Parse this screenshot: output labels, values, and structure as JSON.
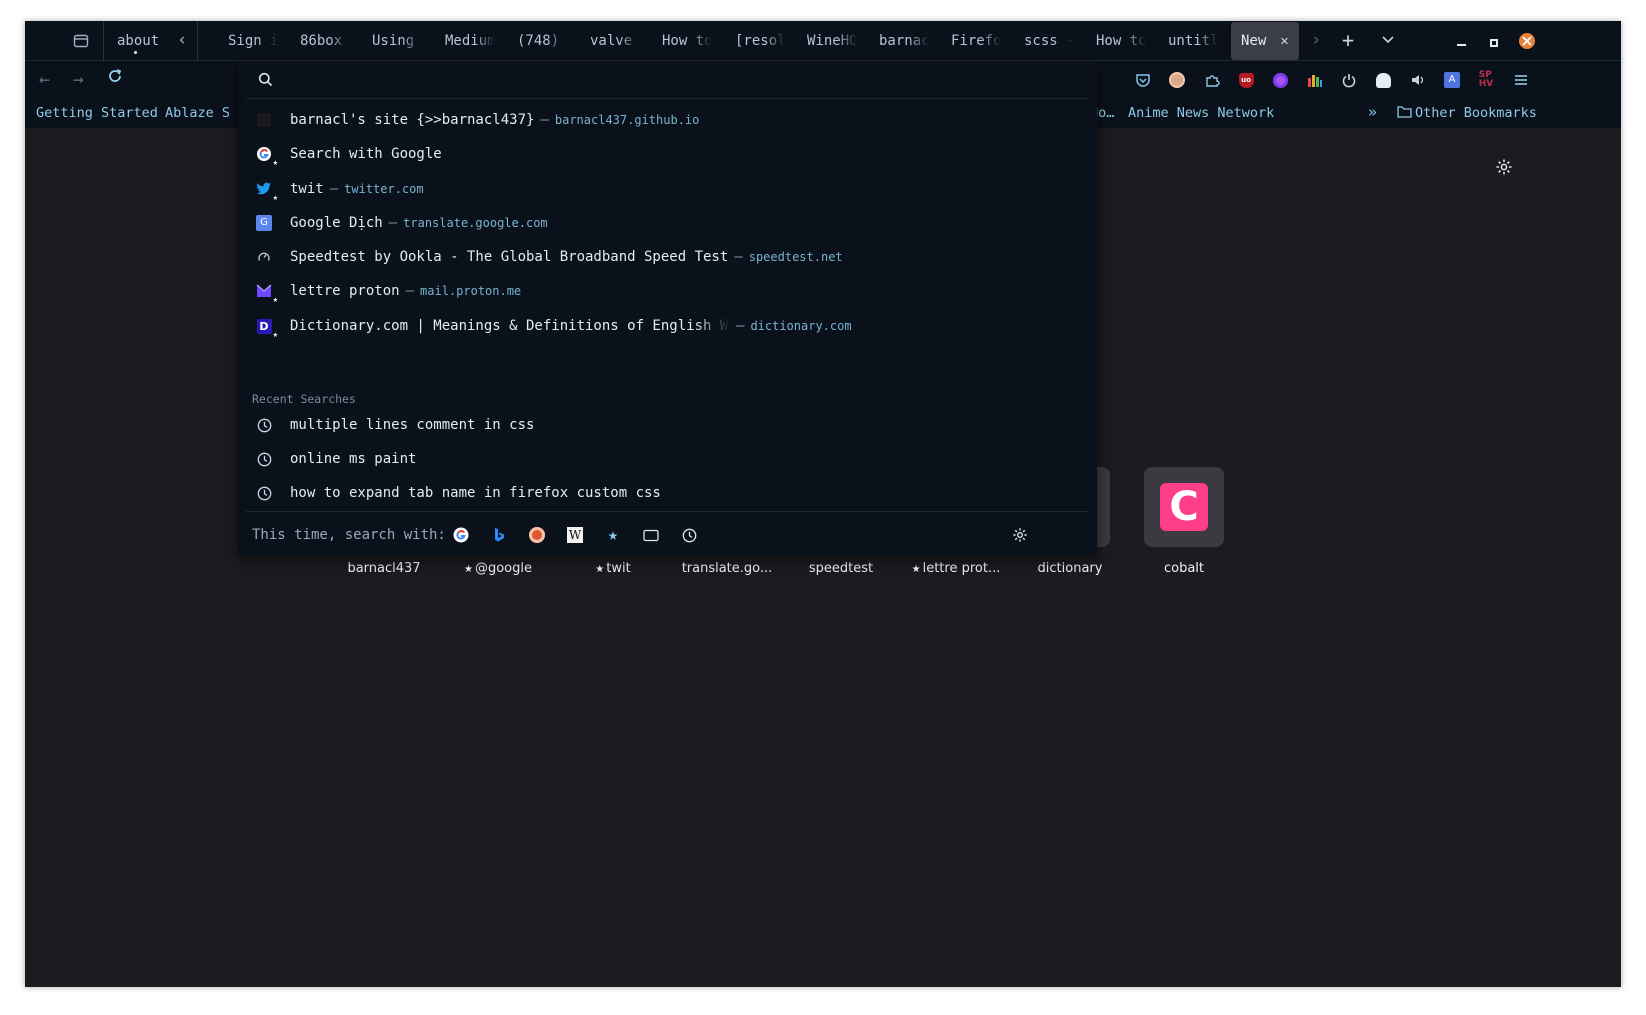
{
  "tabs": {
    "pinned": "about",
    "items": [
      "Sign i",
      "86box",
      "Using",
      "Medium",
      "(748)",
      "valve",
      "How to",
      "[resol",
      "WineHQ",
      "barnac",
      "Firefo",
      "scss -",
      "How to",
      "untitl"
    ],
    "selected": {
      "label": "New",
      "close": "✕"
    }
  },
  "bookmarks": {
    "left": [
      "Getting Started",
      "Ablaze S"
    ],
    "right": [
      "on Does No…",
      "Anime News Network"
    ],
    "other": "Other Bookmarks"
  },
  "urlbar": {
    "value": "",
    "results": [
      {
        "title": "barnacl's site {>>barnacl437}",
        "url": "barnacl437.github.io",
        "icon": "barnacl-favicon",
        "pinned": false
      },
      {
        "title": "Search with Google",
        "url": "",
        "icon": "google-icon",
        "pinned": true
      },
      {
        "title": "twit",
        "url": "twitter.com",
        "icon": "twitter-icon",
        "pinned": true
      },
      {
        "title": "Google Dịch",
        "url": "translate.google.com",
        "icon": "translate-icon",
        "pinned": false
      },
      {
        "title": "Speedtest by Ookla - The Global Broadband Speed Test",
        "url": "speedtest.net",
        "icon": "speedtest-icon",
        "pinned": false
      },
      {
        "title": "lettre proton",
        "url": "mail.proton.me",
        "icon": "proton-icon",
        "pinned": true
      },
      {
        "title": "Dictionary.com | Meanings & Definitions of English Wor",
        "url": "dictionary.com",
        "icon": "dictionary-icon",
        "pinned": true
      }
    ],
    "recent_label": "Recent Searches",
    "recent": [
      "multiple lines comment in css",
      "online ms paint",
      "how to expand tab name in firefox custom css"
    ],
    "oneoff_label": "This time, search with:",
    "engines": [
      "google",
      "bing",
      "duckduckgo",
      "wikipedia",
      "bookmarks",
      "tabs",
      "history"
    ]
  },
  "topsites": [
    {
      "label": "barnacl437",
      "pinned": false
    },
    {
      "label": "@google",
      "pinned": true
    },
    {
      "label": "twit",
      "pinned": true
    },
    {
      "label": "translate.go...",
      "pinned": false
    },
    {
      "label": "speedtest",
      "pinned": false
    },
    {
      "label": "lettre prot...",
      "pinned": true
    },
    {
      "label": "dictionary",
      "pinned": false
    },
    {
      "label": "cobalt",
      "pinned": false
    }
  ],
  "colors": {
    "chrome": "#0b111b",
    "content": "#1c1b1f",
    "link": "#78b3cf",
    "accent": "#00c8f0",
    "cobalt": "#ff3e8a"
  }
}
